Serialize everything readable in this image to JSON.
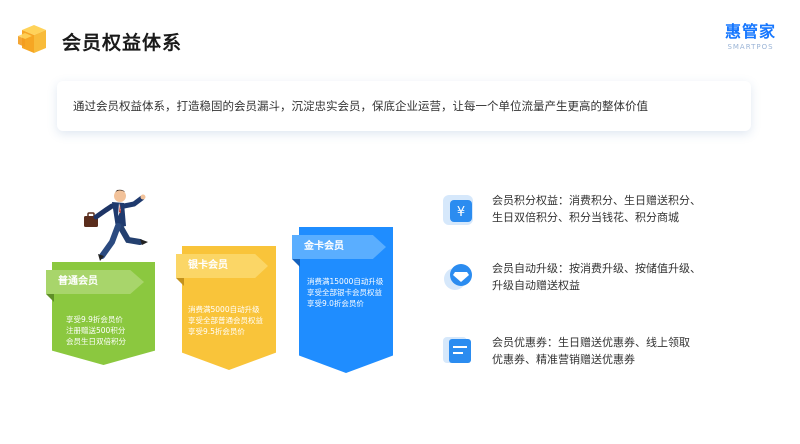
{
  "header": {
    "title": "会员权益体系",
    "brand_name": "惠管家",
    "brand_sub": "SMARTPOS"
  },
  "banner": {
    "text": "通过会员权益体系，打造稳固的会员漏斗，沉淀忠实会员，保底企业运营，让每一个单位流量产生更高的整体价值"
  },
  "tiers": [
    {
      "name": "普通会员",
      "color": "#8bc83f",
      "lines": [
        "享受9.9折会员价",
        "注册赠送500积分",
        "会员生日双倍积分"
      ]
    },
    {
      "name": "银卡会员",
      "color": "#f9c43a",
      "lines": [
        "消费满5000自动升级",
        "享受全部普通会员权益",
        "享受9.5折会员价"
      ]
    },
    {
      "name": "金卡会员",
      "color": "#1f8dff",
      "lines": [
        "消费满15000自动升级",
        "享受全部银卡会员权益",
        "享受9.0折会员价"
      ]
    }
  ],
  "benefits": [
    {
      "icon": "yen-icon",
      "line1": "会员积分权益：消费积分、生日赠送积分、",
      "line2": "生日双倍积分、积分当钱花、积分商城"
    },
    {
      "icon": "diamond-icon",
      "line1": "会员自动升级：按消费升级、按储值升级、",
      "line2": "升级自动赠送权益"
    },
    {
      "icon": "coupon-icon",
      "line1": "会员优惠券：生日赠送优惠券、线上领取",
      "line2": "优惠券、精准营销赠送优惠券"
    }
  ],
  "colors": {
    "accent": "#1677ff",
    "icon_bg": "#dbeafc",
    "icon_fg": "#2b8cf0"
  }
}
